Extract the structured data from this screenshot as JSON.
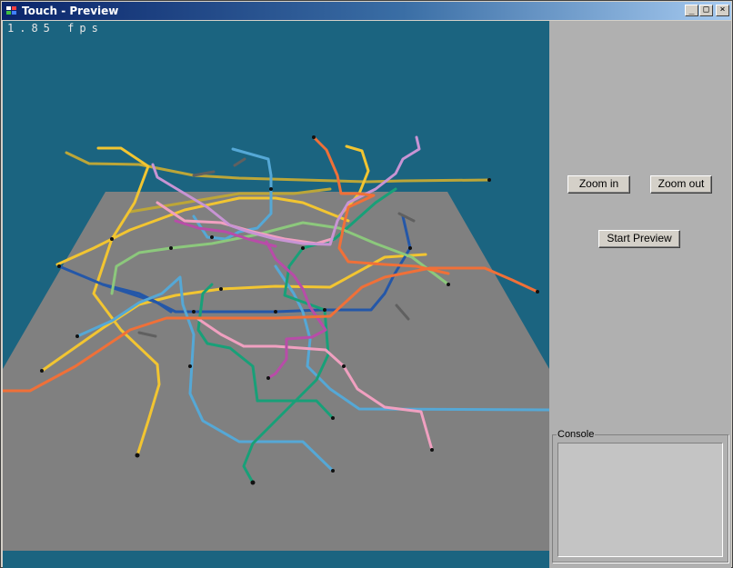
{
  "window": {
    "title": "Touch - Preview",
    "controls": {
      "minimize": "_",
      "maximize": "□",
      "close": "×"
    }
  },
  "viewport": {
    "fps_text": "1.85 fps",
    "background_color": "#1b6480",
    "plane_color": "#808080"
  },
  "panel": {
    "zoom_in_label": "Zoom in",
    "zoom_out_label": "Zoom out",
    "start_preview_label": "Start Preview",
    "console_label": "Console",
    "console_text": ""
  },
  "colors": {
    "yellow": "#f2c531",
    "olive": "#bca638",
    "blue": "#2457a8",
    "lightblue": "#55a8d6",
    "green": "#18a078",
    "lightgreen": "#8cc87c",
    "pink": "#f0a0c0",
    "magenta": "#b84ca8",
    "orange": "#f07038",
    "lilac": "#c894d4",
    "gray": "#606060"
  },
  "icons": [
    "app-icon",
    "minimize-icon",
    "maximize-icon",
    "close-icon"
  ]
}
